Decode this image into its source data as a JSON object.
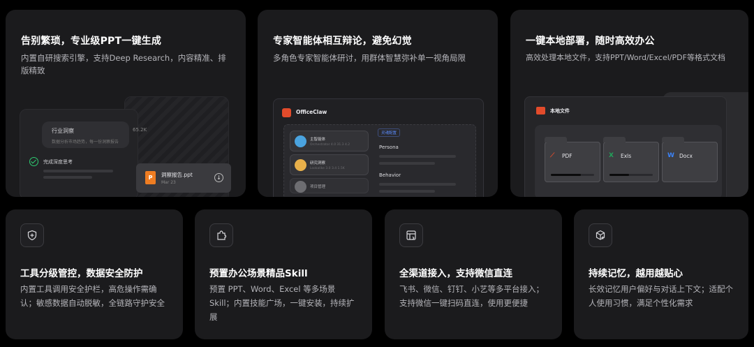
{
  "cards_top": [
    {
      "title": "告别繁琐，专业级PPT一键生成",
      "desc": "内置自研搜索引擎，支持Deep Research，内容精准、排版精致"
    },
    {
      "title": "专家智能体相互辩论，避免幻觉",
      "desc": "多角色专家智能体研讨，用群体智慧弥补单一视角局限"
    },
    {
      "title": "一键本地部署，随时高效办公",
      "desc": "高效处理本地文件，支持PPT/Word/Excel/PDF等格式文档"
    }
  ],
  "illus1": {
    "bubble_title": "行业洞察",
    "bubble_sub": "数据分析市场趋势，每一份洞察报告",
    "done_label": "完成深度思考",
    "value": "65.2K",
    "file_name": "洞察报告.ppt",
    "file_date": "Mar 23",
    "file_icon_letter": "P"
  },
  "illus2": {
    "app_name": "OfficeClaw",
    "agents": [
      {
        "name": "主智能体",
        "sub": "Orchestrator 4.0 31.3 4.2",
        "color": "#4aa3df"
      },
      {
        "name": "研究洞察",
        "sub": "Lookalike 3.0 3.4 1.5K",
        "color": "#e8b04a"
      },
      {
        "name": "项目管理",
        "sub": "",
        "color": "#8a8a8e"
      }
    ],
    "tag": "灵魂配置",
    "fields": [
      "Persona",
      "Behavior"
    ]
  },
  "illus3": {
    "title": "本地文件",
    "files": [
      {
        "label": "PDF",
        "icon": "pdf-icon",
        "color": "#e24b2b",
        "progress": 0.7
      },
      {
        "label": "Exls",
        "icon": "excel-icon",
        "color": "#22a25a",
        "progress": 0.45
      },
      {
        "label": "Docx",
        "icon": "word-icon",
        "color": "#3b82f6",
        "progress": 0
      }
    ]
  },
  "cards_bottom": [
    {
      "title": "工具分级管控，数据安全防护",
      "desc": "内置工具调用安全护栏，高危操作需确认；敏感数据自动脱敏，全链路守护安全",
      "icon": "shield-plus-icon"
    },
    {
      "title": "预置办公场景精品Skill",
      "desc": "预置 PPT、Word、Excel 等多场景 Skill；内置技能广场，一键安装，持续扩展",
      "icon": "puzzle-icon"
    },
    {
      "title": "全渠道接入，支持微信直连",
      "desc": "飞书、微信、钉钉、小艺等多平台接入；支持微信一键扫码直连，使用更便捷",
      "icon": "layout-icon"
    },
    {
      "title": "持续记忆，越用越贴心",
      "desc": "长效记忆用户偏好与对话上下文；适配个人使用习惯，满足个性化需求",
      "icon": "box-plus-icon"
    }
  ]
}
